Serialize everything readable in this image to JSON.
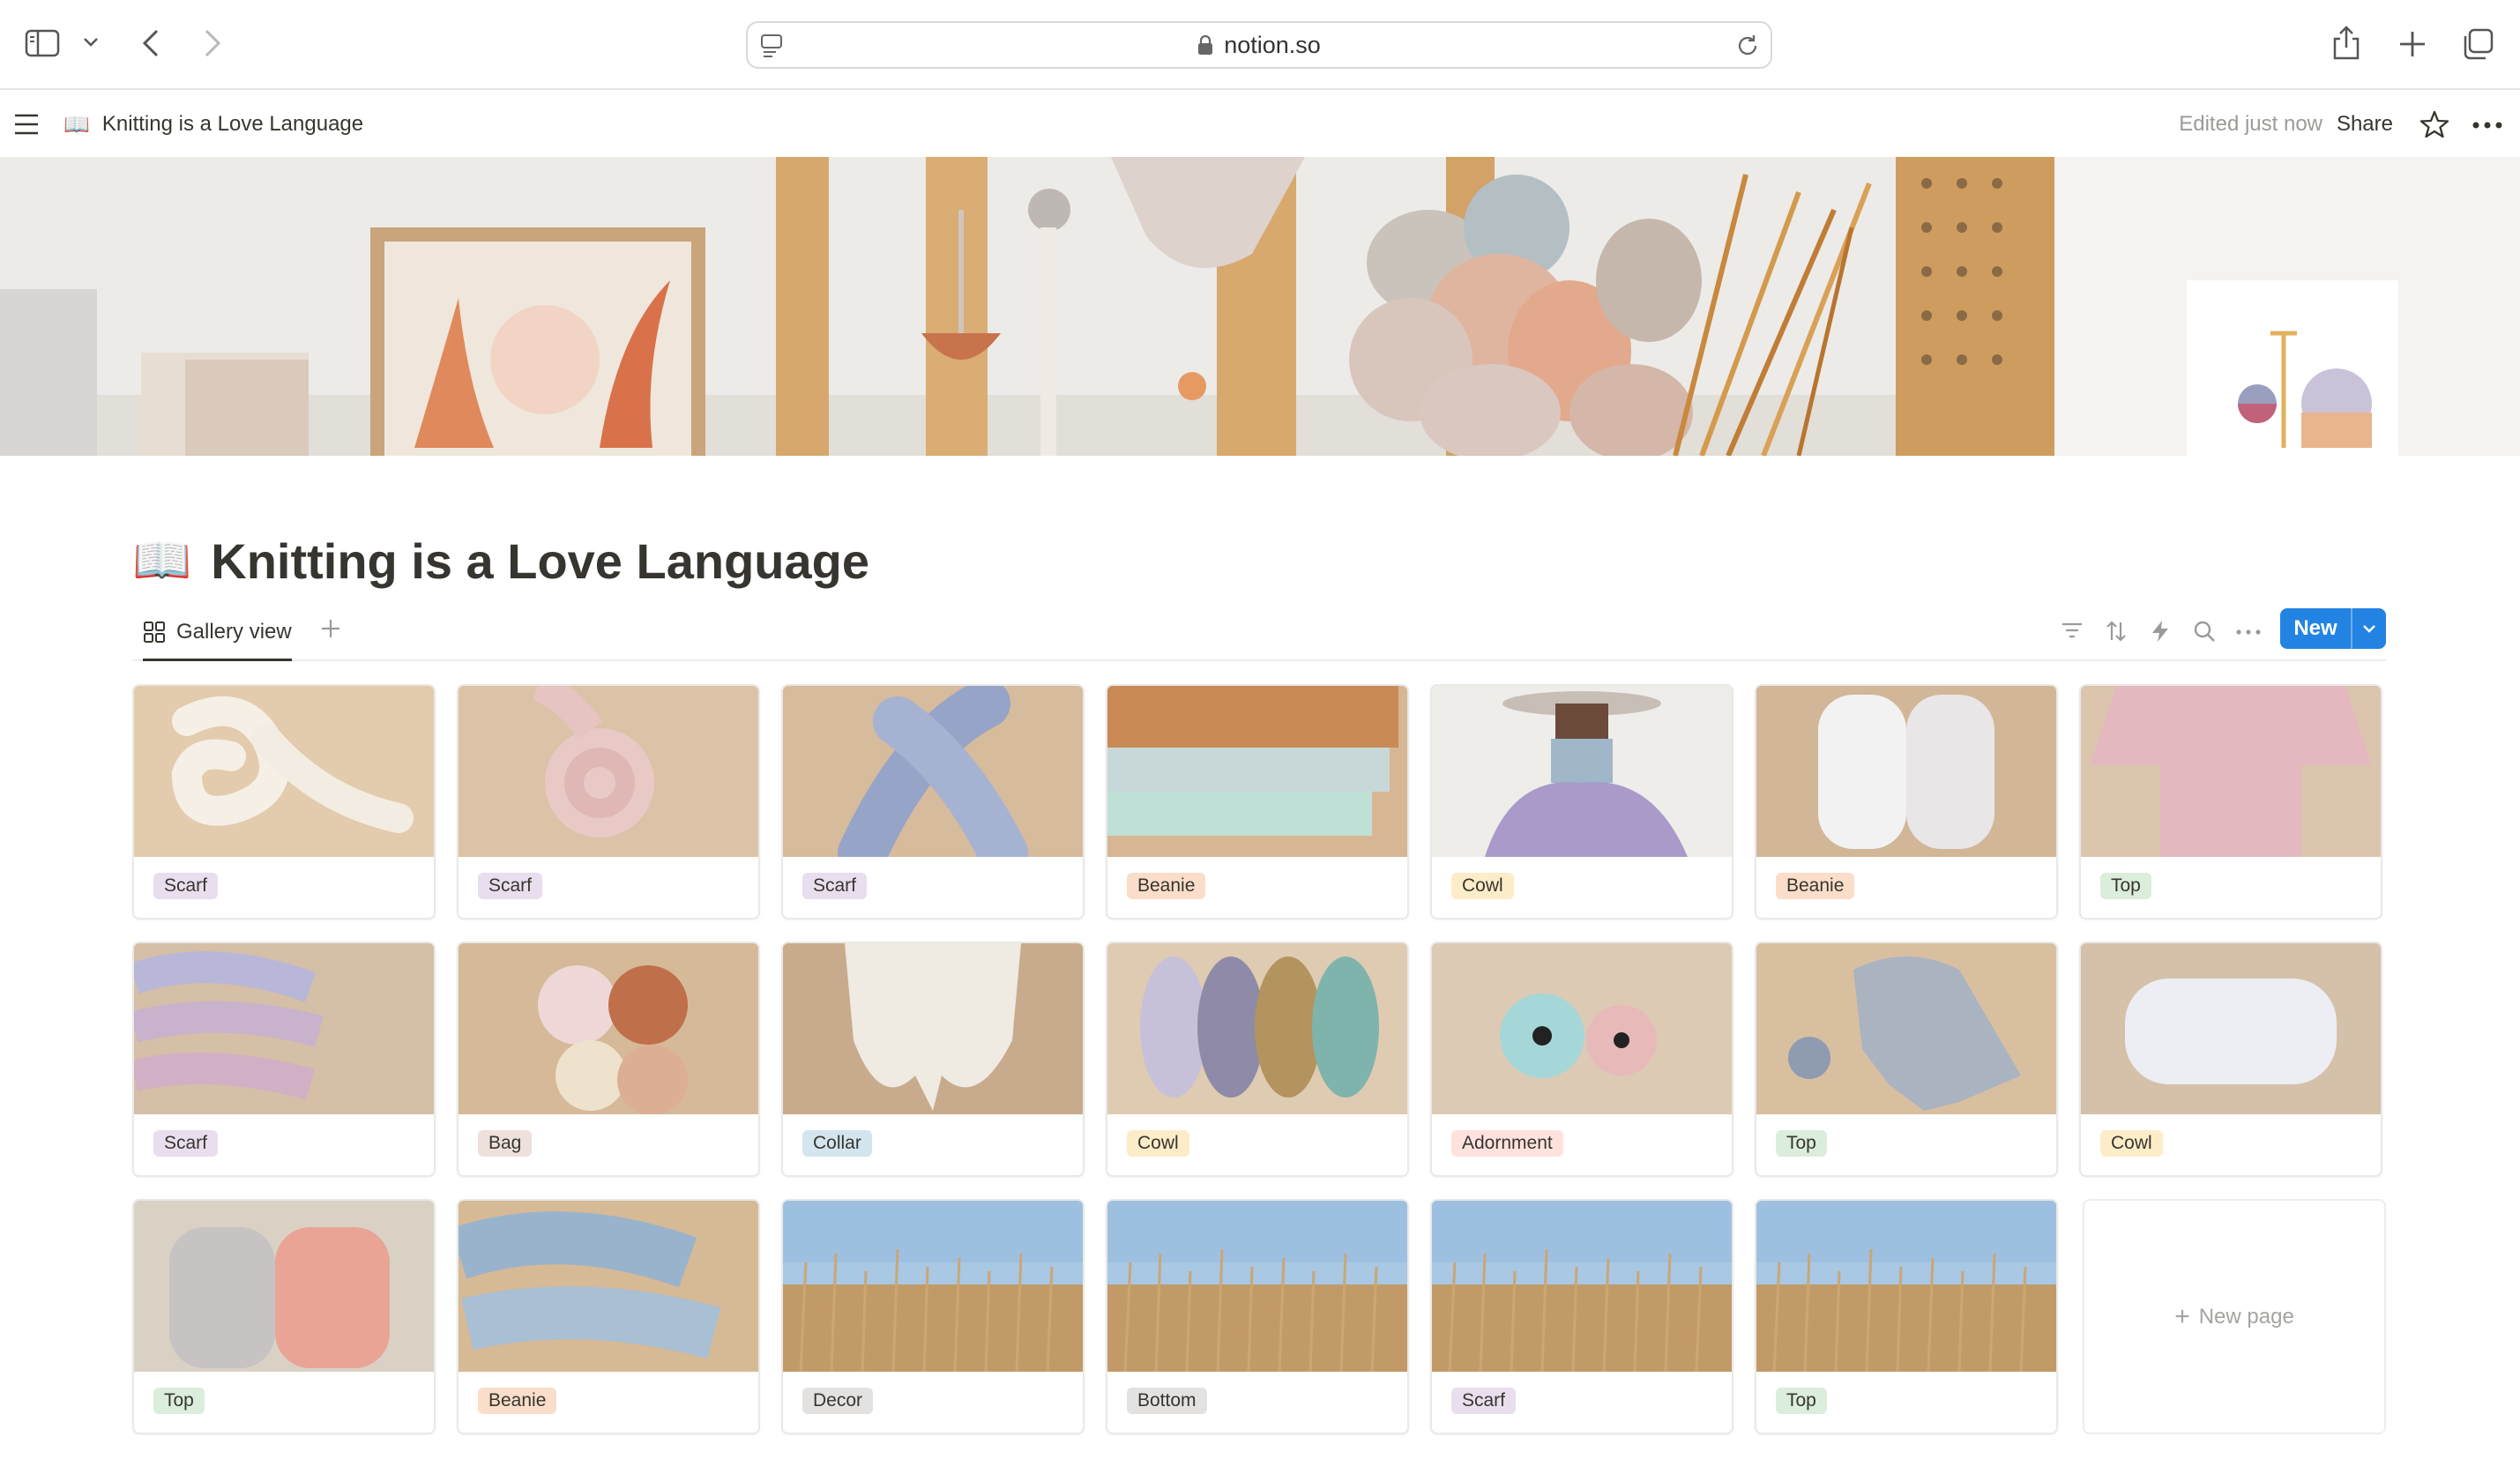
{
  "browser": {
    "url": "notion.so"
  },
  "topbar": {
    "page_emoji": "📖",
    "breadcrumb": "Knitting is a Love Language",
    "edited": "Edited just now",
    "share": "Share"
  },
  "page": {
    "emoji": "📖",
    "title": "Knitting is a Love Language"
  },
  "view": {
    "tab_label": "Gallery view",
    "new_button": "New"
  },
  "cards": [
    {
      "tag": "Scarf",
      "tag_color": "#e8deee",
      "thumb": "scarf-cream"
    },
    {
      "tag": "Scarf",
      "tag_color": "#e8deee",
      "thumb": "scarf-pink"
    },
    {
      "tag": "Scarf",
      "tag_color": "#e8deee",
      "thumb": "scarf-blue"
    },
    {
      "tag": "Beanie",
      "tag_color": "#fadec9",
      "thumb": "beanie-stack"
    },
    {
      "tag": "Cowl",
      "tag_color": "#fdecc8",
      "thumb": "cowl-model"
    },
    {
      "tag": "Beanie",
      "tag_color": "#fadec9",
      "thumb": "yarn-cones-white"
    },
    {
      "tag": "Top",
      "tag_color": "#dbeddb",
      "thumb": "top-pink"
    },
    {
      "tag": "Scarf",
      "tag_color": "#e8deee",
      "thumb": "skeins-lilac"
    },
    {
      "tag": "Bag",
      "tag_color": "#eee0da",
      "thumb": "yarn-balls-mixed"
    },
    {
      "tag": "Collar",
      "tag_color": "#d3e5ef",
      "thumb": "collar-cream"
    },
    {
      "tag": "Cowl",
      "tag_color": "#fdecc8",
      "thumb": "skeins-row"
    },
    {
      "tag": "Adornment",
      "tag_color": "#ffe2dd",
      "thumb": "cord-spools"
    },
    {
      "tag": "Top",
      "tag_color": "#dbeddb",
      "thumb": "top-grey"
    },
    {
      "tag": "Cowl",
      "tag_color": "#fdecc8",
      "thumb": "cone-white"
    },
    {
      "tag": "Top",
      "tag_color": "#dbeddb",
      "thumb": "yarn-grey-pink"
    },
    {
      "tag": "Beanie",
      "tag_color": "#fadec9",
      "thumb": "skeins-blue"
    },
    {
      "tag": "Decor",
      "tag_color": "#e3e2e0",
      "thumb": "field"
    },
    {
      "tag": "Bottom",
      "tag_color": "#e3e2e0",
      "thumb": "field"
    },
    {
      "tag": "Scarf",
      "tag_color": "#e8deee",
      "thumb": "field"
    },
    {
      "tag": "Top",
      "tag_color": "#dbeddb",
      "thumb": "field"
    }
  ],
  "new_page_label": "New page",
  "colors": {
    "accent": "#2383e2",
    "text": "#37352f",
    "muted": "#9b9a97"
  }
}
